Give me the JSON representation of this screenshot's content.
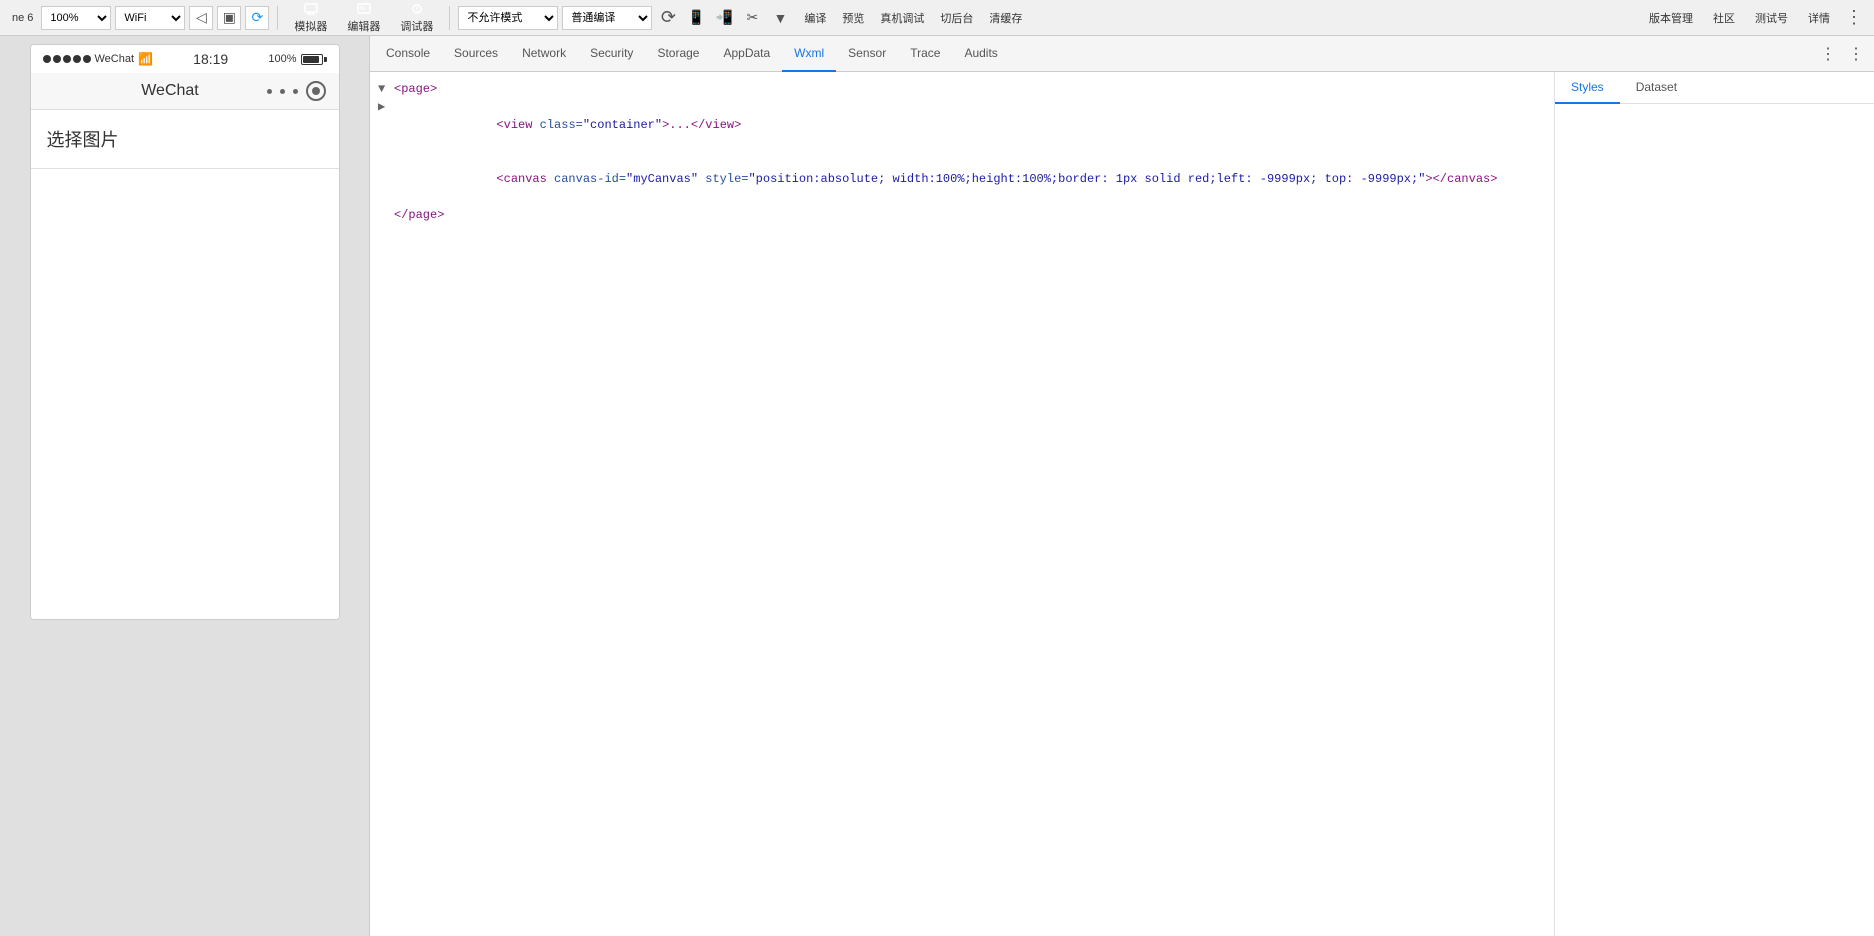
{
  "toolbar": {
    "simulator_label": "模拟器",
    "editor_label": "编辑器",
    "debugger_label": "调试器",
    "compile_label": "编译",
    "preview_label": "预览",
    "real_device_label": "真机调试",
    "cut_label": "切后台",
    "clean_save_label": "清缓存",
    "mode_placeholder": "不允许模式",
    "mode_value": "不允许模式",
    "compiler_placeholder": "普通编译",
    "compiler_value": "普通编译",
    "version_mgmt_label": "版本管理",
    "community_label": "社区",
    "test_label": "测试号",
    "detail_label": "详情"
  },
  "simulator": {
    "zoom_label": "ne 6",
    "zoom_value": "100%",
    "network_label": "WiFi",
    "status_dots": "●●●●●",
    "wechat_label": "WeChat",
    "time": "18:19",
    "battery_pct": "100%",
    "app_title": "WeChat",
    "content_label": "选择图片"
  },
  "devtools": {
    "tabs": [
      {
        "id": "console",
        "label": "Console"
      },
      {
        "id": "sources",
        "label": "Sources"
      },
      {
        "id": "network",
        "label": "Network"
      },
      {
        "id": "security",
        "label": "Security"
      },
      {
        "id": "storage",
        "label": "Storage"
      },
      {
        "id": "appdata",
        "label": "AppData"
      },
      {
        "id": "wxml",
        "label": "Wxml",
        "active": true
      },
      {
        "id": "sensor",
        "label": "Sensor"
      },
      {
        "id": "trace",
        "label": "Trace"
      },
      {
        "id": "audits",
        "label": "Audits"
      }
    ],
    "code_lines": [
      {
        "indent": 0,
        "toggle": "▼",
        "content": "<page>"
      },
      {
        "indent": 1,
        "toggle": "▶",
        "content": "<view class=\"container\">...</view>"
      },
      {
        "indent": 1,
        "toggle": "",
        "content": "<canvas canvas-id=\"myCanvas\"  style=\"position:absolute; width:100%;height:100%;border: 1px solid red;left: -9999px; top: -9999px;\"></canvas>"
      },
      {
        "indent": 0,
        "toggle": "",
        "content": "</page>"
      }
    ]
  },
  "styles_panel": {
    "tabs": [
      {
        "id": "styles",
        "label": "Styles",
        "active": true
      },
      {
        "id": "dataset",
        "label": "Dataset"
      }
    ]
  }
}
